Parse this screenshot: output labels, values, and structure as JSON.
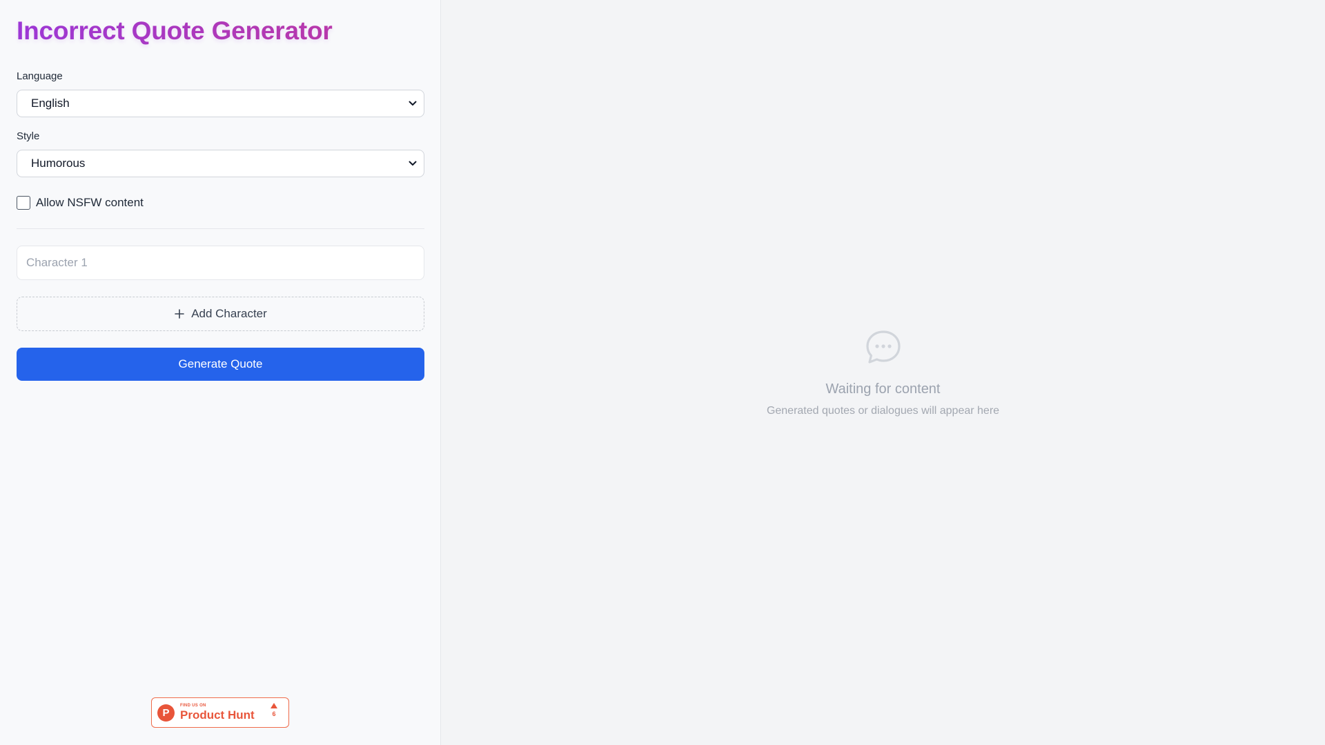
{
  "app": {
    "title": "Incorrect Quote Generator"
  },
  "form": {
    "language_label": "Language",
    "language_value": "English",
    "style_label": "Style",
    "style_value": "Humorous",
    "nsfw_label": "Allow NSFW content",
    "nsfw_checked": false,
    "character_placeholder": "Character 1",
    "add_character_label": "Add Character",
    "generate_label": "Generate Quote"
  },
  "badge": {
    "small_text": "FIND US ON",
    "name": "Product Hunt",
    "votes": "6",
    "logo_letter": "P",
    "color": "#e8553a"
  },
  "empty_state": {
    "icon": "chat-bubble-icon",
    "title": "Waiting for content",
    "subtitle": "Generated quotes or dialogues will appear here"
  },
  "colors": {
    "title_gradient_start": "#9d38d6",
    "title_gradient_end": "#c2379e",
    "primary_button": "#2563eb"
  }
}
